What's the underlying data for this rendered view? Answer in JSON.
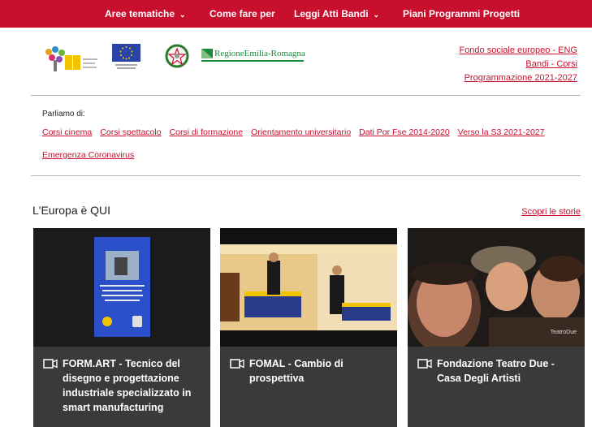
{
  "topnav": {
    "items": [
      {
        "label": "Aree tematiche",
        "dropdown": true
      },
      {
        "label": "Come fare per",
        "dropdown": false
      },
      {
        "label": "Leggi Atti Bandi",
        "dropdown": true
      },
      {
        "label": "Piani Programmi Progetti",
        "dropdown": false
      }
    ],
    "chevron": "⌄",
    "background": "#c8102e"
  },
  "logos": {
    "regione_text": "RegioneEmilia-Romagna"
  },
  "toplinks": [
    "Fondo sociale europeo - ENG",
    "Bandi - Corsi",
    "Programmazione 2021-2027"
  ],
  "parliamo": {
    "label": "Parliamo di:",
    "topics": [
      "Corsi cinema",
      "Corsi spettacolo",
      "Corsi di formazione",
      "Orientamento universitario",
      "Dati Por Fse 2014-2020",
      "Verso la S3 2021-2027",
      "Emergenza Coronavirus"
    ]
  },
  "section": {
    "title": "L'Europa è QUI",
    "cta": "Scopri le storie"
  },
  "cards": [
    {
      "title": "FORM.ART - Tecnico del disegno e progettazione industriale specializzato in smart manufacturing",
      "icon": "video-icon"
    },
    {
      "title": "FOMAL - Cambio di prospettiva",
      "icon": "video-icon"
    },
    {
      "title": "Fondazione Teatro Due - Casa Degli Artisti",
      "icon": "video-icon",
      "watermark": "TeatroDue"
    }
  ],
  "colors": {
    "accent": "#c8102e",
    "card_bg": "#3a3a3a"
  }
}
